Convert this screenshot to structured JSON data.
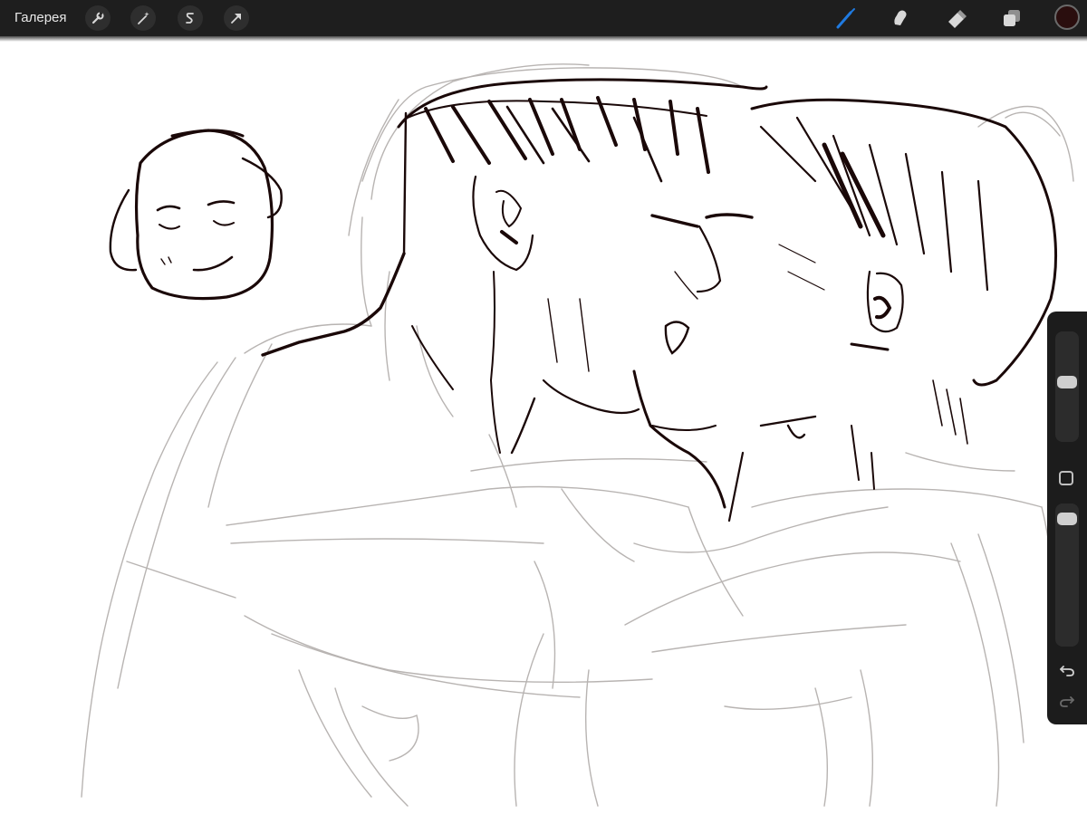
{
  "toolbar": {
    "gallery_label": "Галерея",
    "left_tools": [
      "wrench-icon",
      "magic-wand-icon",
      "selection-s-icon",
      "arrow-cursor-icon"
    ],
    "right_tools": [
      "brush-icon",
      "smudge-icon",
      "eraser-icon",
      "layers-icon"
    ],
    "active_tool": "brush-icon",
    "accent_color": "#1f7ae0",
    "current_color": "#2a0e0e"
  },
  "sidebar": {
    "brush_size_level": 0.55,
    "opacity_level": 0.95,
    "buttons": [
      "modify-square-icon",
      "undo-icon",
      "redo-icon"
    ]
  },
  "canvas": {
    "ink_color": "#1a0808",
    "sketch_color": "#b8b4b2"
  }
}
